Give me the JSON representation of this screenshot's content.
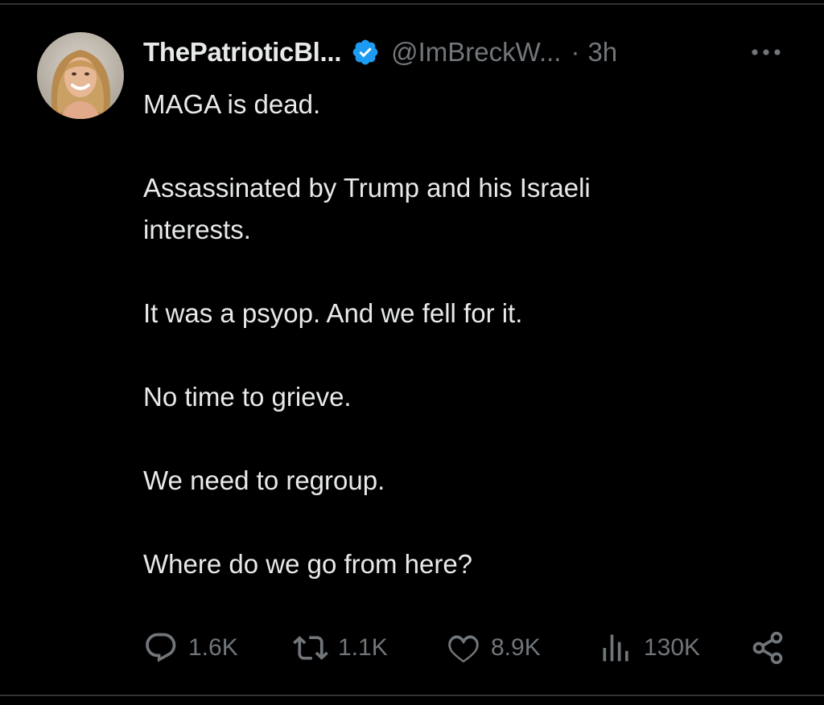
{
  "tweet": {
    "author": {
      "display_name": "ThePatrioticBl...",
      "handle": "@ImBreckW...",
      "verified": true,
      "avatar_icon": "profile-photo"
    },
    "separator": "·",
    "timestamp": "3h",
    "more_icon": "more-dots-icon",
    "text": {
      "p1": "MAGA is dead.",
      "p2_line1": "Assassinated by Trump and his Israeli",
      "p2_line2": "interests.",
      "p3": "It was a psyop. And we fell for it.",
      "p4": "No time to grieve.",
      "p5": "We need to regroup.",
      "p6": "Where do we go from here?"
    },
    "actions": {
      "replies": "1.6K",
      "reposts": "1.1K",
      "likes": "8.9K",
      "views": "130K",
      "reply_icon": "reply-icon",
      "repost_icon": "repost-icon",
      "like_icon": "heart-icon",
      "views_icon": "views-icon",
      "share_icon": "share-icon"
    }
  },
  "colors": {
    "background": "#000000",
    "text": "#e7e9ea",
    "secondary": "#71767b",
    "verified_blue": "#1d9bf0",
    "divider": "#2f3336"
  }
}
